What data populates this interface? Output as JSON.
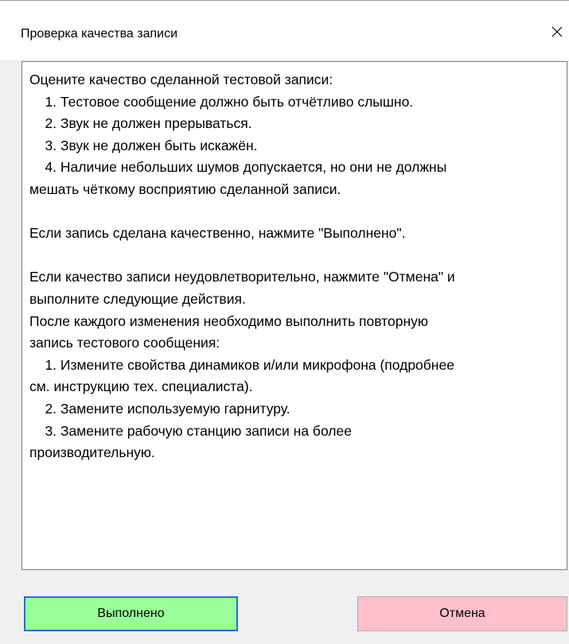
{
  "window": {
    "title": "Проверка качества записи",
    "close_icon": "close-icon"
  },
  "message": {
    "lines": [
      "Оцените качество сделанной тестовой записи:",
      "    1. Тестовое сообщение должно быть отчётливо слышно.",
      "    2. Звук не должен прерываться.",
      "    3. Звук не должен быть искажён.",
      "    4. Наличие небольших шумов допускается, но они не должны",
      "мешать чёткому восприятию сделанной записи.",
      "",
      "Если запись сделана качественно, нажмите \"Выполнено\".",
      "",
      "Если качество записи неудовлетворительно, нажмите \"Отмена\" и",
      "выполните следующие действия.",
      "После каждого изменения необходимо выполнить повторную",
      "запись тестового сообщения:",
      "    1. Измените свойства динамиков и/или микрофона (подробнее",
      "см. инструкцию тех. специалиста).",
      "    2. Замените используемую гарнитуру.",
      "    3. Замените рабочую станцию записи на более",
      "производительную."
    ]
  },
  "buttons": {
    "ok_label": "Выполнено",
    "cancel_label": "Отмена"
  },
  "colors": {
    "ok_background": "#99ff99",
    "ok_focus_border": "#1a73d9",
    "cancel_background": "#ffc0cb"
  }
}
